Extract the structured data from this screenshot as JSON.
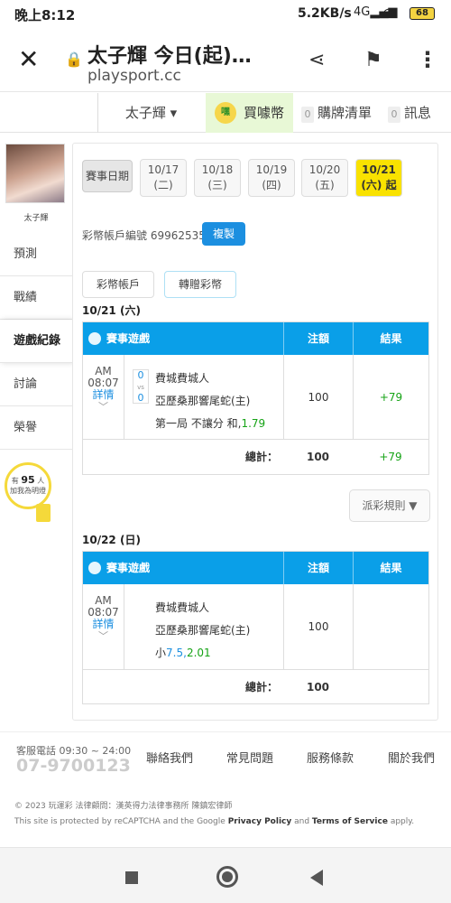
{
  "status_bar": {
    "time": "晚上8:12",
    "network_speed": "5.2KB/s",
    "signal": "4G",
    "battery": "68"
  },
  "browser": {
    "page_title": "太子輝 今日(起)…",
    "url": "playsport.cc"
  },
  "top_nav": {
    "user": "太子輝",
    "coin_icon_text": "嘿",
    "coin_label": "買噱幣",
    "cart_count": "0",
    "cart_label": "購牌清單",
    "msg_count": "0",
    "msg_label": "訊息"
  },
  "sidebar": {
    "username": "太子輝",
    "items": [
      {
        "label": "預測"
      },
      {
        "label": "戰績"
      },
      {
        "label": "遊戲紀錄"
      },
      {
        "label": "討論"
      },
      {
        "label": "榮譽"
      }
    ],
    "bulb": {
      "prefix": "有",
      "count": "95",
      "suffix": "人",
      "line2": "加我為明燈"
    }
  },
  "main": {
    "date_label": "賽事日期",
    "dates": [
      {
        "date": "10/17",
        "day": "(二)"
      },
      {
        "date": "10/18",
        "day": "(三)"
      },
      {
        "date": "10/19",
        "day": "(四)"
      },
      {
        "date": "10/20",
        "day": "(五)"
      },
      {
        "date": "10/21",
        "day": "(六) 起"
      }
    ],
    "account_text": "彩幣帳戶編號 69962535",
    "copy_label": "複製",
    "tab_account": "彩幣帳戶",
    "tab_transfer": "轉贈彩幣",
    "rules_label": "派彩規則 ▼",
    "days": [
      {
        "header": "10/21 (六)",
        "col_game": "賽事遊戲",
        "col_amount": "注額",
        "col_result": "結果",
        "time_ampm": "AM",
        "time": "08:07",
        "details": "詳情",
        "score_a": "0",
        "score_vs": "vs",
        "score_b": "0",
        "team1": "費城費城人",
        "team2": "亞歷桑那響尾蛇(主)",
        "pick_text": "第一局 不讓分 和,",
        "pick_odds": "1.79",
        "amount": "100",
        "result": "+79",
        "total_label": "總計：",
        "total_amount": "100",
        "total_result": "+79"
      },
      {
        "header": "10/22 (日)",
        "col_game": "賽事遊戲",
        "col_amount": "注額",
        "col_result": "結果",
        "time_ampm": "AM",
        "time": "08:07",
        "details": "詳情",
        "team1": "費城費城人",
        "team2": "亞歷桑那響尾蛇(主)",
        "pick_text": "小",
        "pick_line": "7.5",
        "pick_odds": "2.01",
        "amount": "100",
        "result": "",
        "total_label": "總計：",
        "total_amount": "100",
        "total_result": ""
      }
    ]
  },
  "footer": {
    "phone_label": "客服電話 09:30 ~ 24:00",
    "phone": "07-9700123",
    "links": [
      "聯絡我們",
      "常見問題",
      "服務條款",
      "關於我們"
    ],
    "copyright": "© 2023 玩運彩 法律顧問：漢英得力法律事務所 陳鎮宏律師",
    "captcha_prefix": "This site is protected by reCAPTCHA and the Google",
    "privacy": "Privacy Policy",
    "and": "and",
    "terms": "Terms of Service",
    "apply": "apply."
  },
  "colors": {
    "accent": "#0a9fe8",
    "win": "#16a316",
    "highlight": "#f9e200",
    "copy_button": "#1c8fe0"
  }
}
